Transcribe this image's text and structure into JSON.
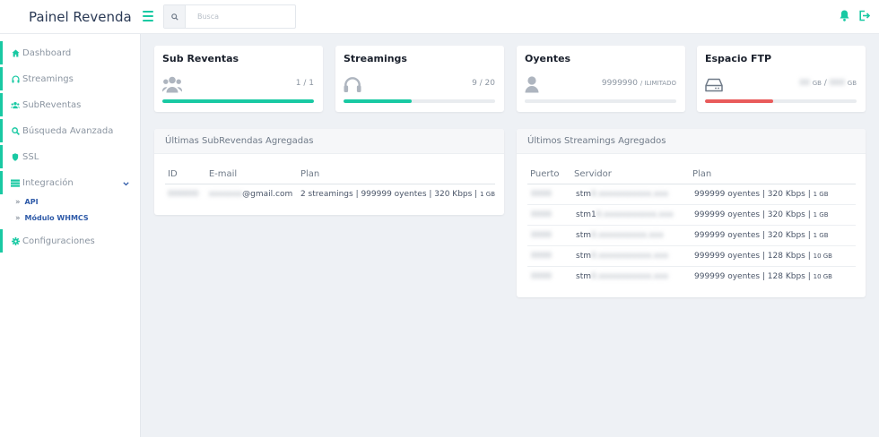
{
  "brand": "Painel Revenda",
  "search": {
    "placeholder": "Busca"
  },
  "colors": {
    "accent": "#19c9a3",
    "danger": "#e95b5b"
  },
  "sidebar": {
    "items": [
      {
        "label": "Dashboard",
        "icon": "home-icon"
      },
      {
        "label": "Streamings",
        "icon": "headphones-icon"
      },
      {
        "label": "SubReventas",
        "icon": "users-icon"
      },
      {
        "label": "Búsqueda Avanzada",
        "icon": "search-icon"
      },
      {
        "label": "SSL",
        "icon": "shield-icon"
      },
      {
        "label": "Integración",
        "icon": "server-icon"
      },
      {
        "label": "Configuraciones",
        "icon": "gear-icon"
      }
    ],
    "submenu": [
      {
        "label": "API"
      },
      {
        "label": "Módulo WHMCS"
      }
    ]
  },
  "stats": [
    {
      "title": "Sub Reventas",
      "value": "1 / 1",
      "progress": 1.0,
      "icon": "users-icon"
    },
    {
      "title": "Streamings",
      "value": "9 / 20",
      "progress": 0.45,
      "icon": "headphones-icon"
    },
    {
      "title": "Oyentes",
      "value": "9999990",
      "value_suffix": "/ ILIMITADO",
      "progress": 0,
      "icon": "user-icon"
    },
    {
      "title": "Espacio FTP",
      "used": "00",
      "unit1": "GB",
      "total": "000",
      "unit2": "GB",
      "progress": 0.45,
      "icon": "hdd-icon"
    }
  ],
  "subreventas_panel": {
    "title": "Últimas SubRevendas Agregadas",
    "columns": [
      "ID",
      "E-mail",
      "Plan"
    ],
    "rows": [
      {
        "id": "000000",
        "email_user": "xxxxxxx",
        "email_domain": "@gmail.com",
        "plan": "2 streamings | 999999 oyentes | 320 Kbps |",
        "plan_suffix": "1 GB"
      }
    ]
  },
  "streamings_panel": {
    "title": "Últimos Streamings Agregados",
    "columns": [
      "Puerto",
      "Servidor",
      "Plan"
    ],
    "rows": [
      {
        "puerto": "0000",
        "srv_prefix": "stm",
        "srv_rest": "0.xxxxxxxxxxx.xxx",
        "plan": "999999 oyentes | 320 Kbps |",
        "plan_suffix": "1 GB"
      },
      {
        "puerto": "0000",
        "srv_prefix": "stm1",
        "srv_rest": "0.xxxxxxxxxxx.xxx",
        "plan": "999999 oyentes | 320 Kbps |",
        "plan_suffix": "1 GB"
      },
      {
        "puerto": "0000",
        "srv_prefix": "stm",
        "srv_rest": "0.xxxxxxxxxx.xxx",
        "plan": "999999 oyentes | 320 Kbps |",
        "plan_suffix": "1 GB"
      },
      {
        "puerto": "0000",
        "srv_prefix": "stm",
        "srv_rest": "0.xxxxxxxxxxx.xxx",
        "plan": "999999 oyentes | 128 Kbps |",
        "plan_suffix": "10 GB"
      },
      {
        "puerto": "0000",
        "srv_prefix": "stm",
        "srv_rest": "0.xxxxxxxxxxx.xxx",
        "plan": "999999 oyentes | 128 Kbps |",
        "plan_suffix": "10 GB"
      }
    ]
  }
}
